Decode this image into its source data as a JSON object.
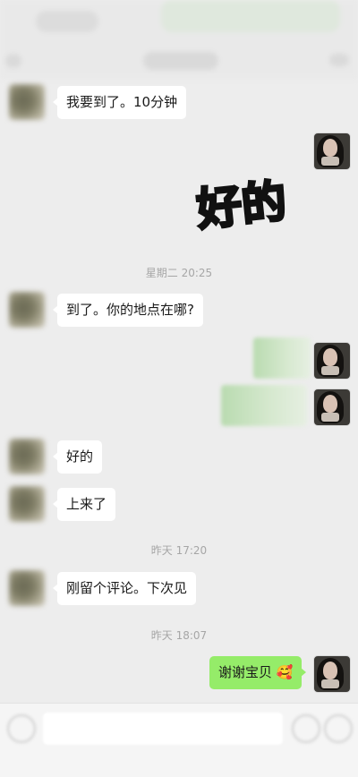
{
  "messages": [
    {
      "text": "我要到了。10分钟"
    },
    {
      "text": "到了。你的地点在哪?"
    },
    {
      "text": "好的"
    },
    {
      "text": "上来了"
    },
    {
      "text": "刚留个评论。下次见"
    },
    {
      "text": "谢谢宝贝"
    }
  ],
  "sticker": {
    "text": "好的"
  },
  "times": [
    "星期二 20:25",
    "昨天 17:20",
    "昨天 18:07"
  ],
  "emoji": {
    "reply": "🥰"
  },
  "colors": {
    "background": "#ededed",
    "bubble_out": "#95ec69",
    "bubble_in": "#ffffff",
    "timestamp": "#a6a6a6"
  },
  "icons": [
    "voice-icon",
    "emoji-icon",
    "plus-icon",
    "back-icon",
    "more-icon"
  ]
}
